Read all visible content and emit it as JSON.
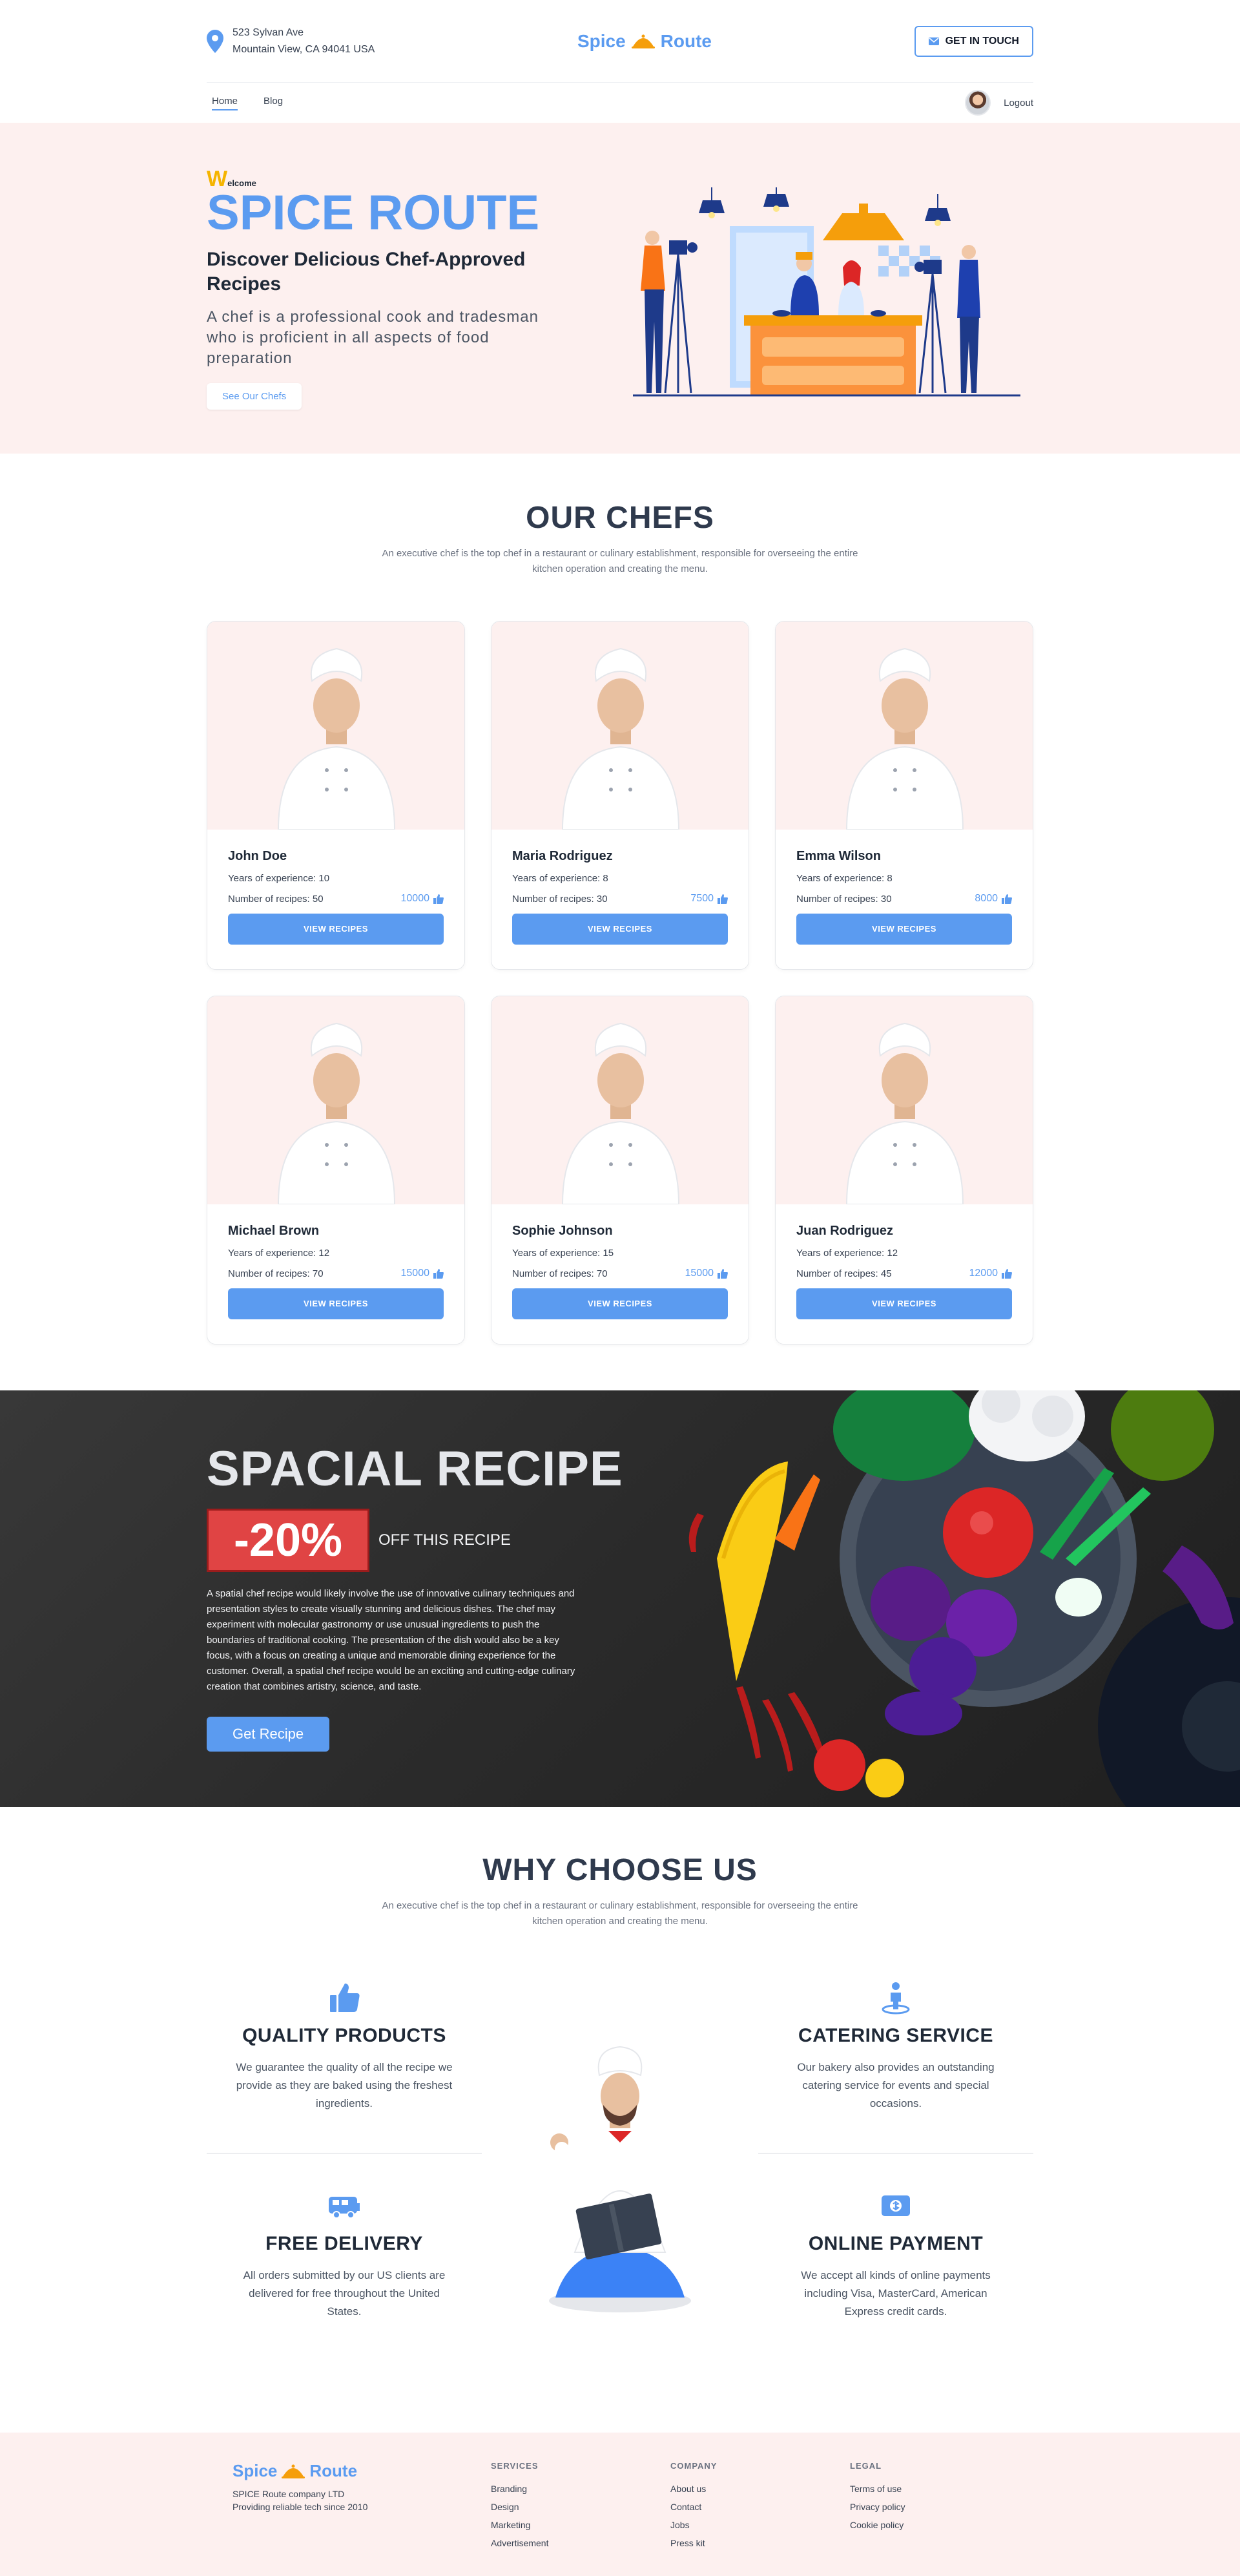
{
  "header": {
    "address_line1": "523 Sylvan Ave",
    "address_line2": "Mountain View, CA 94041 USA",
    "logo_word1": "Spice",
    "logo_word2": "Route",
    "touch_label": "GET IN TOUCH",
    "nav": {
      "home": "Home",
      "blog": "Blog",
      "logout": "Logout"
    }
  },
  "hero": {
    "welcome_initial": "W",
    "welcome_rest": "elcome",
    "title": "SPICE ROUTE",
    "subtitle": "Discover Delicious Chef-Approved Recipes",
    "description": "A chef is a professional cook and tradesman who is proficient in all aspects of food preparation",
    "button": "See Our Chefs"
  },
  "chefs": {
    "title": "OUR CHEFS",
    "description": "An executive chef is the top chef in a restaurant or culinary establishment, responsible for overseeing the entire kitchen operation and creating the menu.",
    "experience_label": "Years of experience:",
    "recipes_label": "Number of recipes:",
    "button": "VIEW RECIPES",
    "items": [
      {
        "name": "John Doe",
        "years": "10",
        "recipes": "50",
        "likes": "10000"
      },
      {
        "name": "Maria Rodriguez",
        "years": "8",
        "recipes": "30",
        "likes": "7500"
      },
      {
        "name": "Emma Wilson",
        "years": "8",
        "recipes": "30",
        "likes": "8000"
      },
      {
        "name": "Michael Brown",
        "years": "12",
        "recipes": "70",
        "likes": "15000"
      },
      {
        "name": "Sophie Johnson",
        "years": "15",
        "recipes": "70",
        "likes": "15000"
      },
      {
        "name": "Juan Rodriguez",
        "years": "12",
        "recipes": "45",
        "likes": "12000"
      }
    ]
  },
  "special": {
    "title": "SPACIAL RECIPE",
    "discount": "-20%",
    "off_text": "OFF THIS RECIPE",
    "description": "A spatial chef recipe would likely involve the use of innovative culinary techniques and presentation styles to create visually stunning and delicious dishes. The chef may experiment with molecular gastronomy or use unusual ingredients to push the boundaries of traditional cooking. The presentation of the dish would also be a key focus, with a focus on creating a unique and memorable dining experience for the customer. Overall, a spatial chef recipe would be an exciting and cutting-edge culinary creation that combines artistry, science, and taste.",
    "button": "Get Recipe"
  },
  "why": {
    "title": "WHY CHOOSE US",
    "description": "An executive chef is the top chef in a restaurant or culinary establishment, responsible for overseeing the entire kitchen operation and creating the menu.",
    "features": [
      {
        "icon": "thumbs-up-icon",
        "title": "QUALITY PRODUCTS",
        "text": "We guarantee the quality of all the recipe we provide as they are baked using the freshest ingredients."
      },
      {
        "icon": "person-pin-icon",
        "title": "CATERING SERVICE",
        "text": "Our bakery also provides an outstanding catering service for events and special occasions."
      },
      {
        "icon": "truck-icon",
        "title": "FREE DELIVERY",
        "text": "All orders submitted by our US clients are delivered for free throughout the United States."
      },
      {
        "icon": "money-icon",
        "title": "ONLINE PAYMENT",
        "text": "We accept all kinds of online payments including Visa, MasterCard, American Express credit cards."
      }
    ]
  },
  "footer": {
    "company_line1": "SPICE Route company LTD",
    "company_line2": "Providing reliable tech since 2010",
    "services_title": "SERVICES",
    "services": [
      "Branding",
      "Design",
      "Marketing",
      "Advertisement"
    ],
    "company_title": "COMPANY",
    "company": [
      "About us",
      "Contact",
      "Jobs",
      "Press kit"
    ],
    "legal_title": "LEGAL",
    "legal": [
      "Terms of use",
      "Privacy policy",
      "Cookie policy"
    ]
  },
  "colors": {
    "accent": "#5b9bf0",
    "hero_bg": "#fdf0ef",
    "discount": "#e04444",
    "dark_title": "#2f3a4d"
  }
}
